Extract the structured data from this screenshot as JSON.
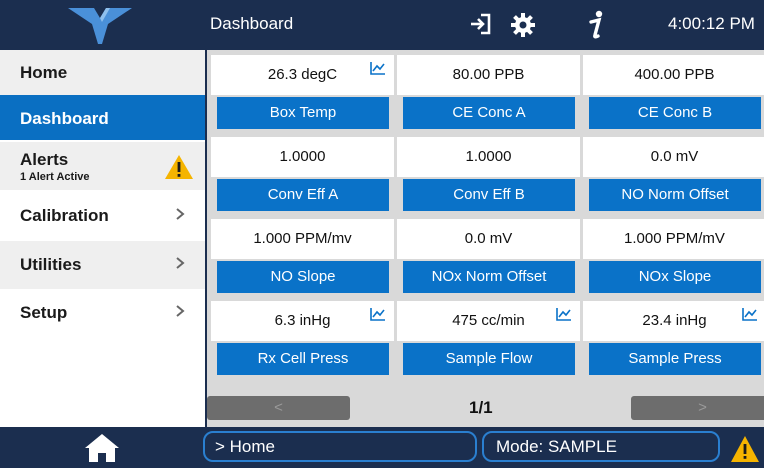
{
  "header": {
    "title": "Dashboard",
    "time": "4:00:12 PM",
    "icons": [
      "logo-icon",
      "sign-in-icon",
      "gear-icon",
      "info-icon"
    ]
  },
  "sidebar": {
    "items": [
      {
        "label": "Home"
      },
      {
        "label": "Dashboard"
      },
      {
        "label": "Alerts",
        "sub": "1 Alert Active"
      },
      {
        "label": "Calibration"
      },
      {
        "label": "Utilities"
      },
      {
        "label": "Setup"
      }
    ],
    "chevron": "›"
  },
  "tiles": [
    {
      "value": "26.3 degC",
      "label": "Box Temp",
      "trend": true
    },
    {
      "value": "80.00 PPB",
      "label": "CE Conc A",
      "trend": false
    },
    {
      "value": "400.00 PPB",
      "label": "CE Conc B",
      "trend": false
    },
    {
      "value": "1.0000",
      "label": "Conv Eff A",
      "trend": false
    },
    {
      "value": "1.0000",
      "label": "Conv Eff B",
      "trend": false
    },
    {
      "value": "0.0 mV",
      "label": "NO Norm Offset",
      "trend": false
    },
    {
      "value": "1.000 PPM/mv",
      "label": "NO Slope",
      "trend": false
    },
    {
      "value": "0.0 mV",
      "label": "NOx Norm Offset",
      "trend": false
    },
    {
      "value": "1.000 PPM/mV",
      "label": "NOx Slope",
      "trend": false
    },
    {
      "value": "6.3 inHg",
      "label": "Rx Cell Press",
      "trend": true
    },
    {
      "value": "475 cc/min",
      "label": "Sample Flow",
      "trend": true
    },
    {
      "value": "23.4 inHg",
      "label": "Sample Press",
      "trend": true
    }
  ],
  "pager": {
    "prev": "<",
    "next": ">",
    "count": "1/1"
  },
  "footer": {
    "breadcrumb": "> Home",
    "mode": "Mode: SAMPLE"
  },
  "colors": {
    "header": "#1b2e4f",
    "accent": "#0a72c8",
    "warning": "#f5b400"
  }
}
